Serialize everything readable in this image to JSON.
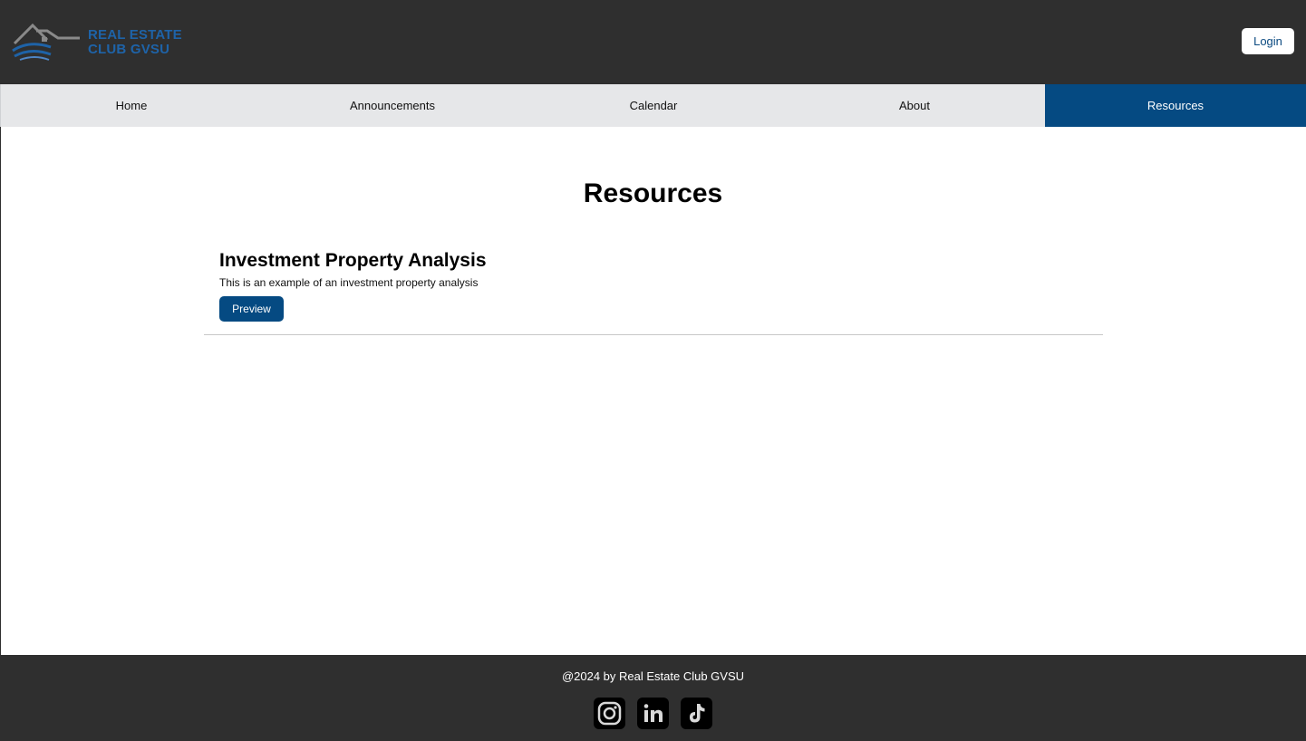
{
  "header": {
    "logo_line1": "REAL ESTATE",
    "logo_line2": "CLUB GVSU",
    "login_label": "Login"
  },
  "nav": {
    "items": [
      {
        "label": "Home"
      },
      {
        "label": "Announcements"
      },
      {
        "label": "Calendar"
      },
      {
        "label": "About"
      },
      {
        "label": "Resources"
      }
    ],
    "active": "Resources"
  },
  "main": {
    "title": "Resources",
    "resources": [
      {
        "title": "Investment Property Analysis",
        "description": "This is an example of an investment property analysis",
        "button_label": "Preview"
      }
    ]
  },
  "footer": {
    "copyright": "@2024 by Real Estate Club GVSU",
    "socials": [
      "instagram-icon",
      "linkedin-icon",
      "tiktok-icon"
    ]
  },
  "colors": {
    "header_bg": "#2f2f2f",
    "nav_bg": "#e6e7e9",
    "accent": "#054a82",
    "logo_blue": "#1e63a8"
  }
}
